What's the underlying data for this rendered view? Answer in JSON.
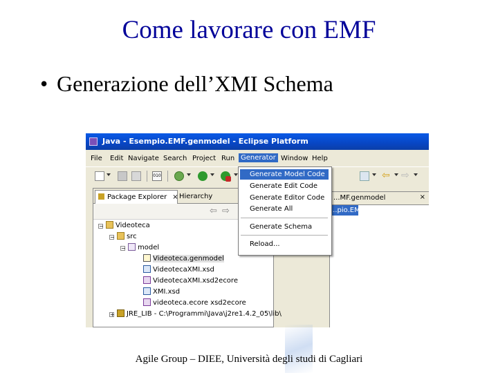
{
  "slide": {
    "title": "Come lavorare con EMF",
    "bullet": "Generazione dell’XMI Schema",
    "footer": "Agile Group – DIEE, Università degli studi di Cagliari"
  },
  "window": {
    "title": "Java - Esempio.EMF.genmodel - Eclipse Platform"
  },
  "menubar": {
    "items": [
      "File",
      "Edit",
      "Navigate",
      "Search",
      "Project",
      "Run",
      "Generator",
      "Window",
      "Help"
    ],
    "active": "Generator"
  },
  "generator_menu": {
    "items": [
      "Generate Model Code",
      "Generate Edit Code",
      "Generate Editor Code",
      "Generate All",
      "Generate Schema",
      "Reload..."
    ],
    "highlighted": "Generate Model Code"
  },
  "views": {
    "package_explorer_tab": "Package Explorer",
    "hierarchy_tab": "Hierarchy",
    "editor_tab": "...MF.genmodel",
    "editor_selected": "...pio.EMF"
  },
  "tree": {
    "project": "Videoteca",
    "src": "src",
    "package": "model",
    "files": [
      "Videoteca.genmodel",
      "VideotecaXMI.xsd",
      "VideotecaXMI.xsd2ecore",
      "XMI.xsd",
      "videoteca.ecore xsd2ecore"
    ],
    "jre": "JRE_LIB - C:\\Programmi\\Java\\j2re1.4.2_05\\lib\\"
  },
  "colors": {
    "title": "#000099",
    "titlebar": "#0846c4",
    "selection": "#316ac5"
  }
}
